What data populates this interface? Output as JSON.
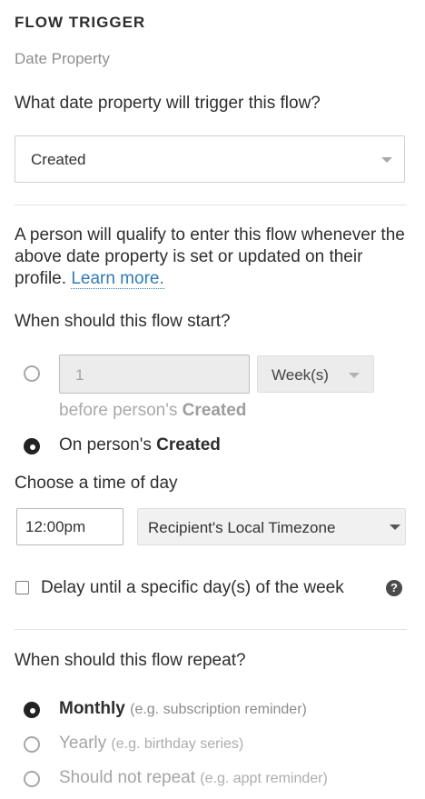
{
  "section": {
    "title": "FLOW TRIGGER",
    "subtitle": "Date Property"
  },
  "date_property": {
    "question": "What date property will trigger this flow?",
    "selected": "Created"
  },
  "description": {
    "text": "A person will qualify to enter this flow whenever the above date property is set or updated on their profile.",
    "link_label": "Learn more."
  },
  "start": {
    "question": "When should this flow start?",
    "offset_option": {
      "number_value": "1",
      "unit_selected": "Week(s)",
      "before_text": "before person's",
      "property": "Created",
      "selected": false
    },
    "on_option": {
      "prefix": "On person's",
      "property": "Created",
      "selected": true
    }
  },
  "time_of_day": {
    "label": "Choose a time of day",
    "time_value": "12:00pm",
    "timezone_selected": "Recipient's Local Timezone"
  },
  "delay": {
    "label": "Delay until a specific day(s) of the week",
    "checked": false,
    "help_icon": "question-circle-icon",
    "help_glyph": "?"
  },
  "repeat": {
    "question": "When should this flow repeat?",
    "options": [
      {
        "label": "Monthly",
        "hint": "(e.g. subscription reminder)",
        "selected": true
      },
      {
        "label": "Yearly",
        "hint": "(e.g. birthday series)",
        "selected": false
      },
      {
        "label": "Should not repeat",
        "hint": "(e.g. appt reminder)",
        "selected": false
      }
    ]
  },
  "colors": {
    "link": "#2f7ab8",
    "radio_selected": "#222222",
    "radio_unselected_border": "#a7a7a7",
    "input_disabled_bg": "#ececec",
    "divider": "#e3e3e3"
  }
}
